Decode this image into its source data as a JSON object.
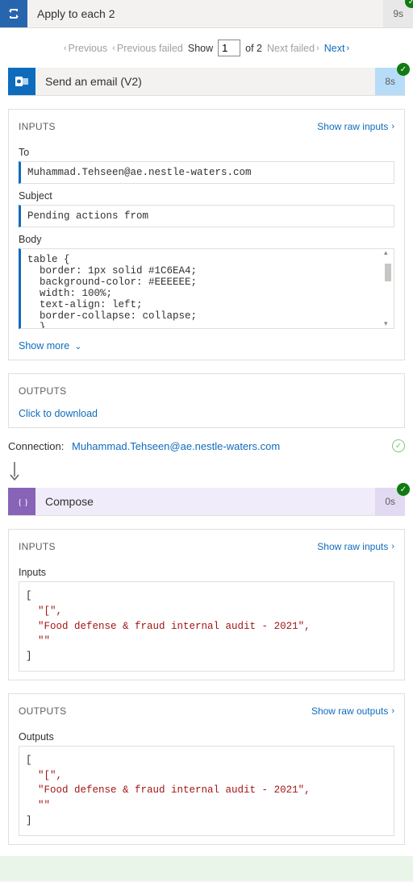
{
  "applyEach": {
    "title": "Apply to each 2",
    "duration": "9s"
  },
  "pagination": {
    "previous": "Previous",
    "previousFailed": "Previous failed",
    "showLabel": "Show",
    "current": "1",
    "totalLabel": "of 2",
    "nextFailed": "Next failed",
    "next": "Next"
  },
  "sendEmail": {
    "title": "Send an email (V2)",
    "duration": "8s",
    "inputs": {
      "header": "INPUTS",
      "rawLink": "Show raw inputs",
      "toLabel": "To",
      "toValue": "Muhammad.Tehseen@ae.nestle-waters.com",
      "subjectLabel": "Subject",
      "subjectValue": "Pending actions from",
      "bodyLabel": "Body",
      "bodyValue": "table {\n  border: 1px solid #1C6EA4;\n  background-color: #EEEEEE;\n  width: 100%;\n  text-align: left;\n  border-collapse: collapse;\n  }",
      "showMore": "Show more"
    },
    "outputs": {
      "header": "OUTPUTS",
      "download": "Click to download"
    },
    "connection": {
      "label": "Connection:",
      "value": "Muhammad.Tehseen@ae.nestle-waters.com"
    }
  },
  "compose": {
    "title": "Compose",
    "duration": "0s",
    "inputs": {
      "header": "INPUTS",
      "rawLink": "Show raw inputs",
      "label": "Inputs",
      "bracketOpen": "[",
      "line1": "\"[\",",
      "line2": "\"Food defense & fraud internal audit - 2021\",",
      "line3": "\"\"",
      "bracketClose": "]"
    },
    "outputs": {
      "header": "OUTPUTS",
      "rawLink": "Show raw outputs",
      "label": "Outputs",
      "bracketOpen": "[",
      "line1": "\"[\",",
      "line2": "\"Food defense & fraud internal audit - 2021\",",
      "line3": "\"\"",
      "bracketClose": "]"
    }
  }
}
